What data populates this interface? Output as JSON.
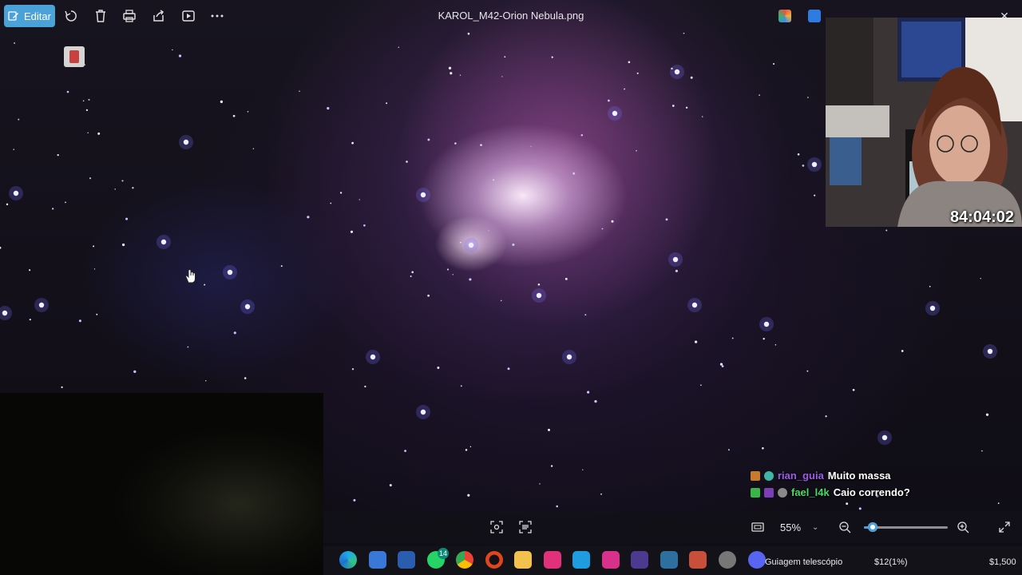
{
  "toolbar": {
    "edit_label": "Editar",
    "file_title": "KAROL_M42-Orion Nebula.png",
    "icons": [
      "edit-icon",
      "rotate-icon",
      "delete-icon",
      "print-icon",
      "share-icon",
      "slideshow-icon",
      "more-icon"
    ]
  },
  "webcam": {
    "timer": "84:04:02"
  },
  "chat": [
    {
      "user": "rian_guia",
      "user_color": "#9b5de5",
      "message": "Muito massa"
    },
    {
      "user": "fael_l4k",
      "user_color": "#4cd964",
      "message": "Caio correndo?"
    }
  ],
  "zoom": {
    "value": "55%",
    "slider_fraction": 0.1
  },
  "taskbar": {
    "whatsapp_badge": "14",
    "stream_title": "Guiagem telescópio",
    "amount": "$12(1%)",
    "goal": "$1,500"
  },
  "colors": {
    "accent": "#4aa2d9",
    "background": "#07060d"
  }
}
